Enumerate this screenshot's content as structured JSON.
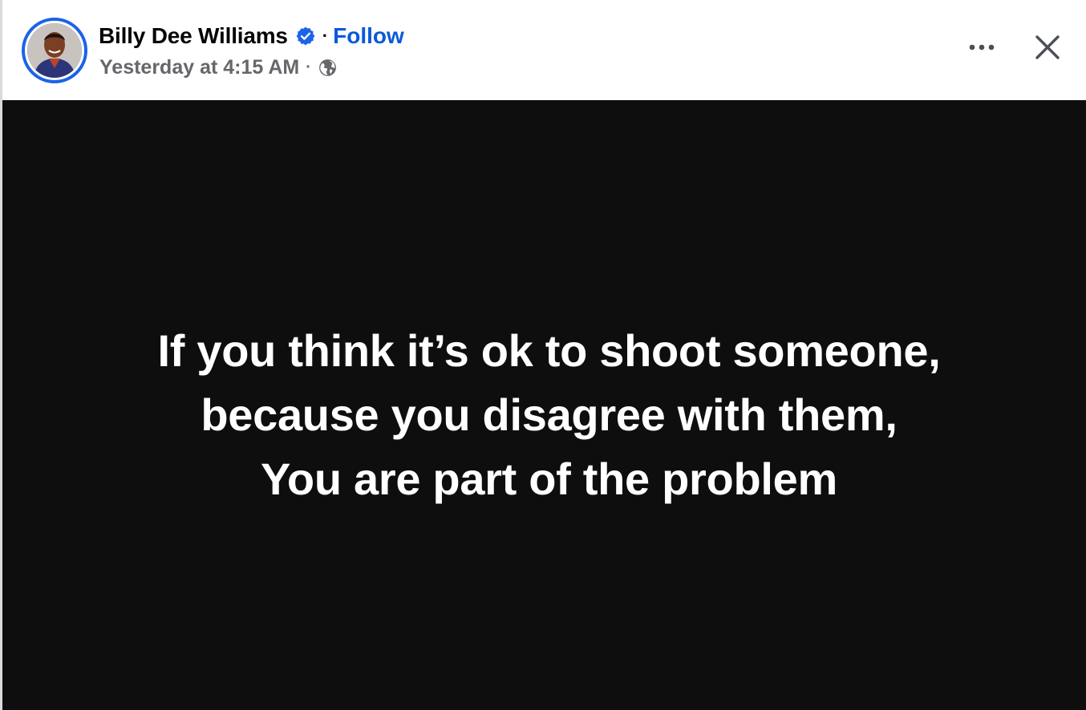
{
  "post": {
    "author": {
      "name": "Billy Dee Williams",
      "verified": true,
      "follow_label": "Follow",
      "avatar": "author-profile-photo"
    },
    "timestamp": "Yesterday at 4:15 AM",
    "separator": "·",
    "audience_icon": "globe-icon",
    "actions": {
      "more_icon": "more-options-icon",
      "close_icon": "close-icon"
    },
    "image_text_lines": [
      "If you think it’s ok to shoot someone,",
      "because you disagree with them,",
      "You are part of the problem"
    ]
  },
  "colors": {
    "verified_badge": "#1b63e8",
    "follow_link": "#0a5ad8",
    "image_background": "#0e0e0e",
    "meta_text": "#65676b"
  }
}
